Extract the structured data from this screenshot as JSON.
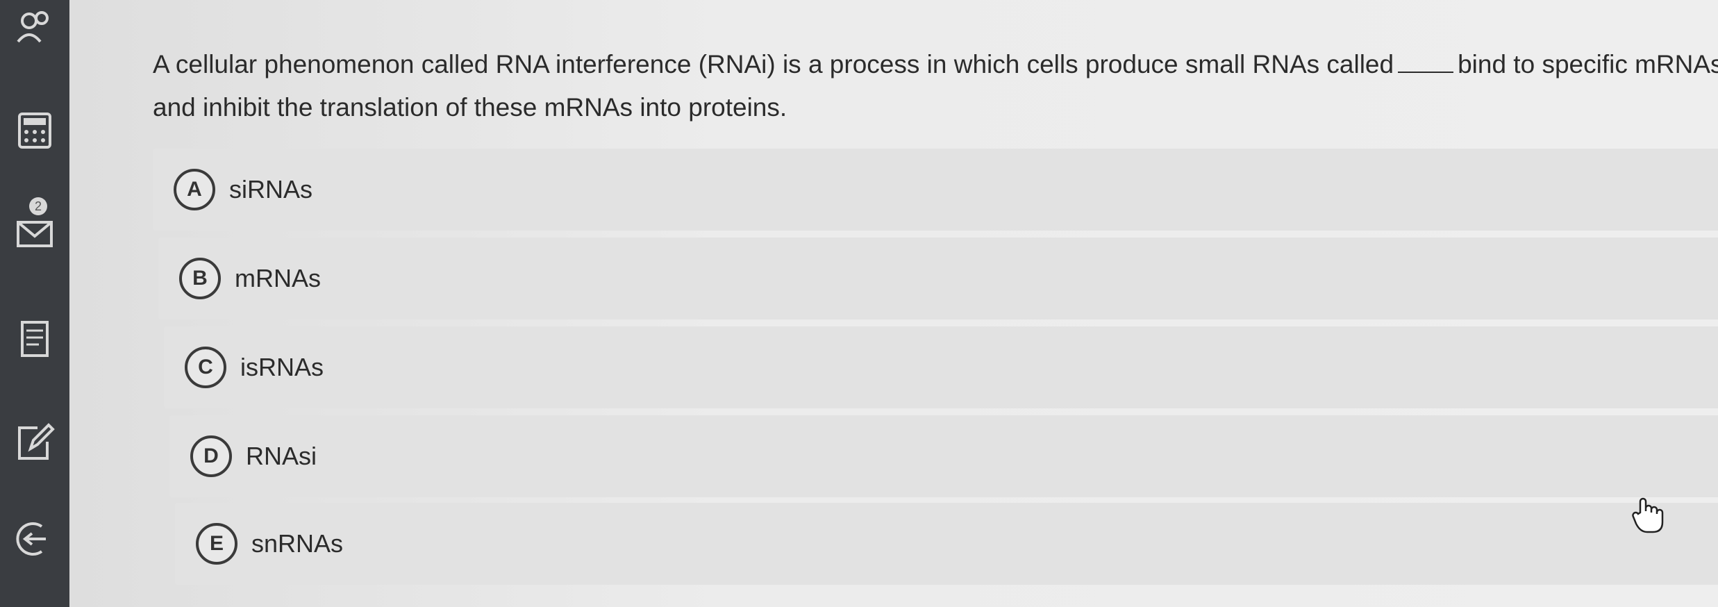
{
  "question": {
    "text_before": "A cellular phenomenon called RNA interference (RNAi) is a process in which cells produce small RNAs called",
    "text_after": "bind to specific mRNAs and inhibit the translation of these mRNAs into proteins."
  },
  "options": [
    {
      "letter": "A",
      "label": "siRNAs"
    },
    {
      "letter": "B",
      "label": "mRNAs"
    },
    {
      "letter": "C",
      "label": "isRNAs"
    },
    {
      "letter": "D",
      "label": "RNAsi"
    },
    {
      "letter": "E",
      "label": "snRNAs"
    }
  ],
  "sidebar": {
    "icons": [
      "people-icon",
      "calculator-icon",
      "mail-icon",
      "notes-icon",
      "edit-icon",
      "exit-icon"
    ],
    "mail_badge": "2"
  }
}
